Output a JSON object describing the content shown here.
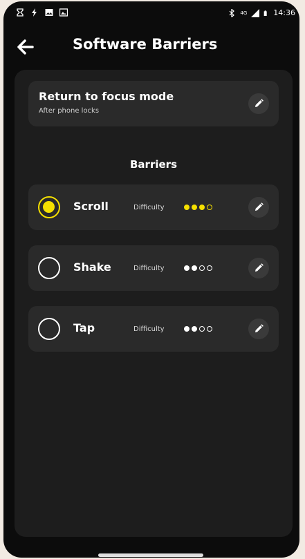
{
  "status_bar": {
    "time": "14:36",
    "network": "4G",
    "left_icons": [
      "hourglass-icon",
      "flash-icon",
      "image-icon",
      "gallery-icon"
    ],
    "right_icons": [
      "bluetooth-icon",
      "signal-icon",
      "battery-icon"
    ]
  },
  "app_bar": {
    "back_icon": "arrow-left-icon",
    "title": "Software Barriers"
  },
  "focus_mode": {
    "title": "Return to focus mode",
    "subtitle": "After phone locks",
    "edit_icon": "pencil-icon"
  },
  "barriers": {
    "heading": "Barriers",
    "items": [
      {
        "name": "Scroll",
        "selected": true,
        "difficulty_label": "Difficulty",
        "difficulty": 3,
        "difficulty_max": 4
      },
      {
        "name": "Shake",
        "selected": false,
        "difficulty_label": "Difficulty",
        "difficulty": 2,
        "difficulty_max": 4
      },
      {
        "name": "Tap",
        "selected": false,
        "difficulty_label": "Difficulty",
        "difficulty": 2,
        "difficulty_max": 4
      }
    ]
  },
  "colors": {
    "accent": "#f5e000",
    "background": "#0c0c0c",
    "panel": "#1d1d1d",
    "card": "#2a2a2a"
  }
}
